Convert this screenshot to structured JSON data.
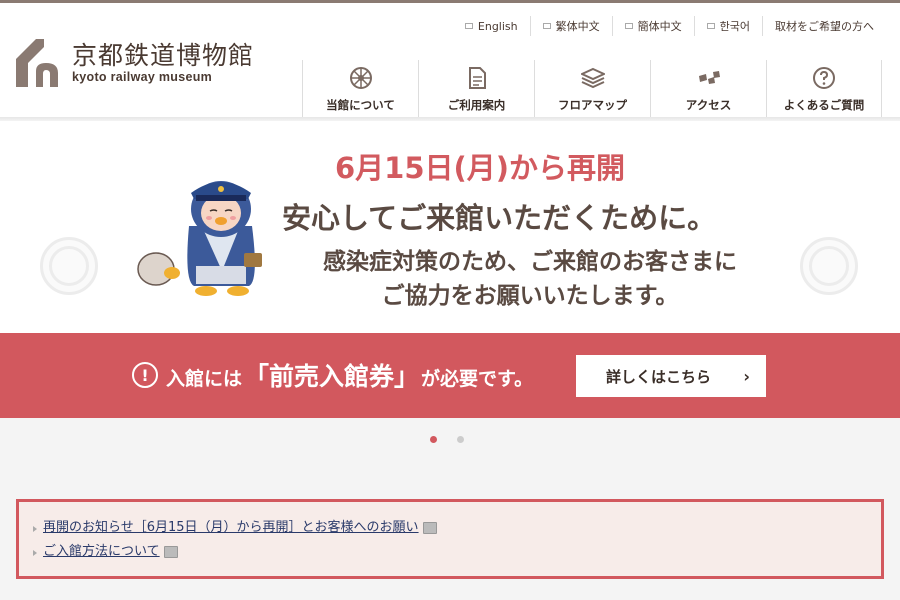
{
  "site": {
    "logo_jp": "京都鉄道博物館",
    "logo_en": "kyoto railway museum"
  },
  "languages": [
    {
      "label": "English",
      "icon": "window-icon"
    },
    {
      "label": "繁体中文",
      "icon": "window-icon"
    },
    {
      "label": "簡体中文",
      "icon": "window-icon"
    },
    {
      "label": "한국어",
      "icon": "window-icon"
    },
    {
      "label": "取材をご希望の方へ",
      "icon": ""
    }
  ],
  "nav": [
    {
      "label": "当館について",
      "icon": "wheel-icon"
    },
    {
      "label": "ご利用案内",
      "icon": "document-icon"
    },
    {
      "label": "フロアマップ",
      "icon": "layers-icon"
    },
    {
      "label": "アクセス",
      "icon": "route-icon"
    },
    {
      "label": "よくあるご質問",
      "icon": "question-icon"
    }
  ],
  "slide": {
    "heading_date": "6月15日(月)から再開",
    "heading_main": "安心してご来館いただくために。",
    "message": "感染症対策のため、ご来館のお客さまに",
    "message2": "ご協力をお願いいたします。"
  },
  "banner": {
    "text_pre": "入館には",
    "text_strong": "「前売入館券」",
    "text_post": "が必要です。",
    "button_label": "詳しくはこちら"
  },
  "notices": [
    "再開のお知らせ［6月15日（月）から再開］とお客様へのお願い",
    "ご入館方法について"
  ],
  "colors": {
    "accent": "#d2585e",
    "text": "#5a4a42",
    "link": "#2a3a6a"
  }
}
